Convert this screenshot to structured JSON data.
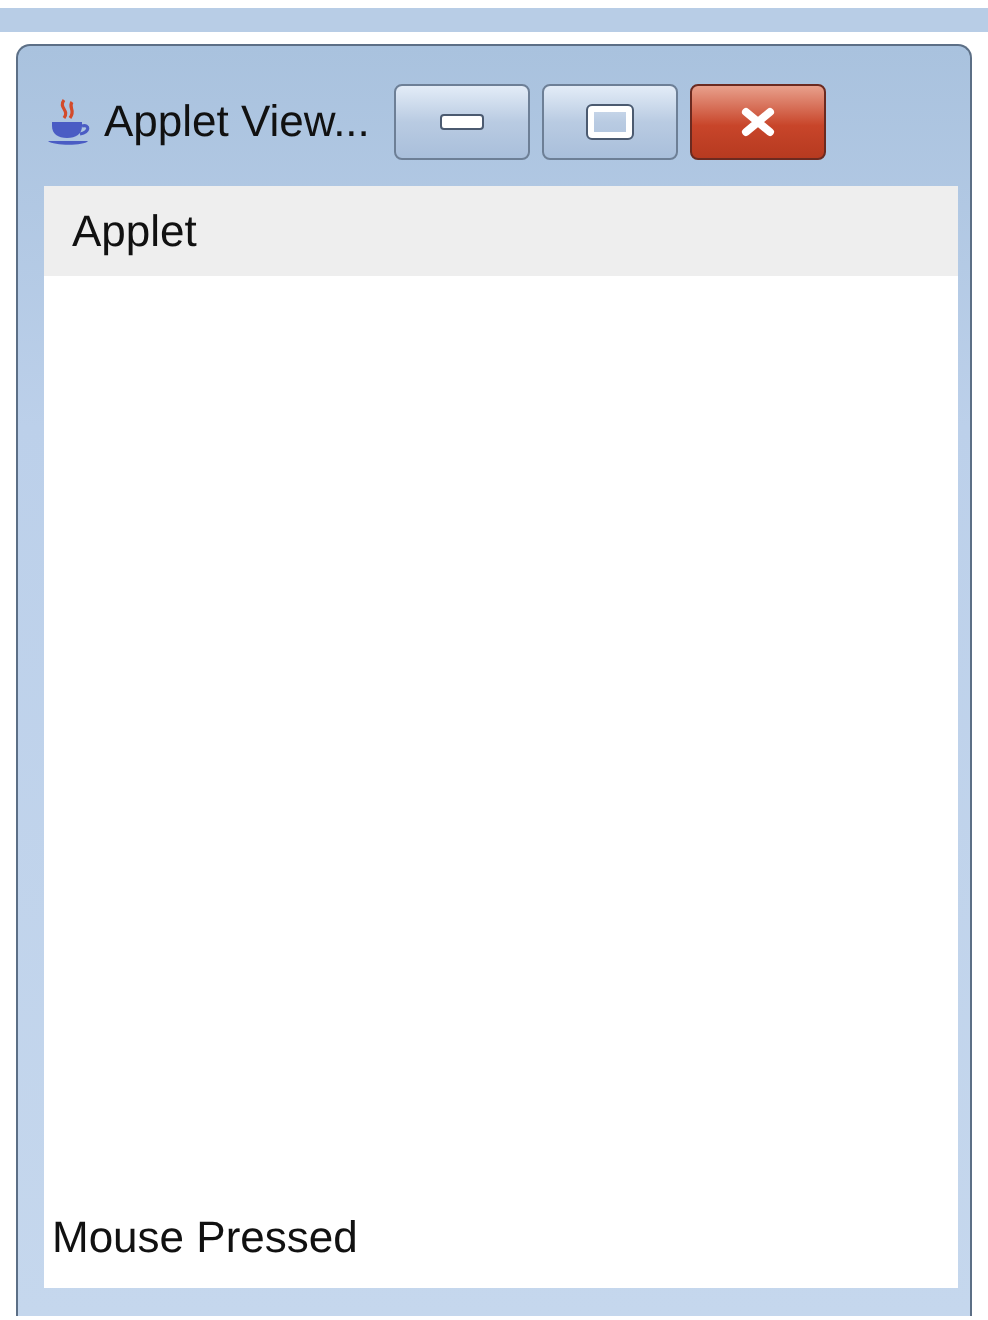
{
  "window": {
    "title": "Applet View..."
  },
  "menu_bar": {
    "items": [
      "Applet"
    ]
  },
  "applet": {
    "status_text": "Mouse Pressed"
  }
}
